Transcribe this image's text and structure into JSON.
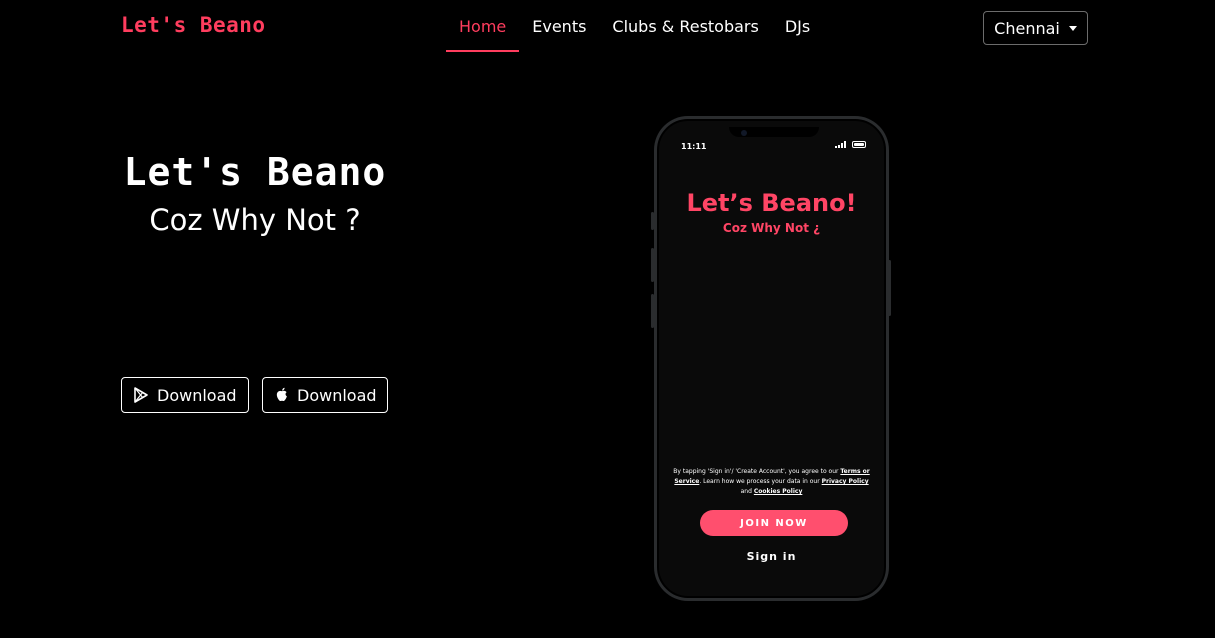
{
  "header": {
    "brand": "Let's Beano",
    "nav": [
      {
        "label": "Home",
        "active": true
      },
      {
        "label": "Events",
        "active": false
      },
      {
        "label": "Clubs & Restobars",
        "active": false
      },
      {
        "label": "DJs",
        "active": false
      }
    ],
    "city_select": {
      "value": "Chennai",
      "icon": "caret-down-icon"
    }
  },
  "hero": {
    "title": "Let's Beano",
    "subtitle": "Coz Why Not ?",
    "buttons": [
      {
        "label": "Download",
        "icon": "google-play-icon"
      },
      {
        "label": "Download",
        "icon": "apple-icon"
      }
    ]
  },
  "phone": {
    "status_time": "11:11",
    "app_title": "Let’s Beano!",
    "app_subtitle": "Coz Why Not ¿",
    "terms": {
      "part1": "By tapping 'Sign in'/ 'Create Account', you agree to our ",
      "terms_link": "Terms or Service",
      "part2": ". Learn how we process your data in our ",
      "privacy_link": "Privacy Policy",
      "part3": " and ",
      "cookies_link": "Cookies Policy"
    },
    "join_button": "JOIN NOW",
    "signin_link": "Sign in"
  },
  "colors": {
    "accent": "#ff3d5e",
    "background": "#000000",
    "button_pink": "#ff4f6e"
  }
}
